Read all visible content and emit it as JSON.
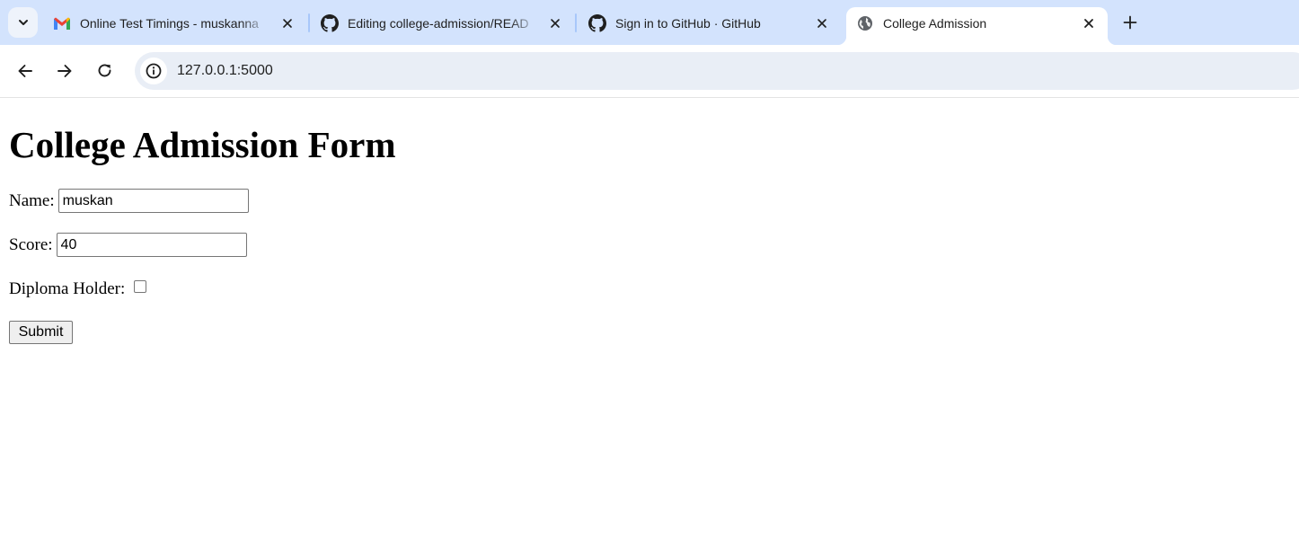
{
  "browser": {
    "tabs": [
      {
        "title": "Online Test Timings - muskanna",
        "icon": "gmail-icon",
        "active": false
      },
      {
        "title": "Editing college-admission/READ",
        "icon": "github-icon",
        "active": false
      },
      {
        "title": "Sign in to GitHub · GitHub",
        "icon": "github-icon",
        "active": false
      },
      {
        "title": "College Admission",
        "icon": "globe-icon",
        "active": true
      }
    ],
    "address_bar": {
      "url": "127.0.0.1:5000",
      "icon": "info-icon"
    },
    "colors": {
      "tabstrip": "#d3e3fd",
      "omnibox": "#e9eef6",
      "active_tab": "#ffffff"
    }
  },
  "page": {
    "heading": "College Admission Form",
    "form": {
      "name_label": "Name:",
      "name_value": "muskan",
      "score_label": "Score:",
      "score_value": "40",
      "diploma_label": "Diploma Holder:",
      "diploma_checked": false,
      "submit_label": "Submit"
    }
  }
}
